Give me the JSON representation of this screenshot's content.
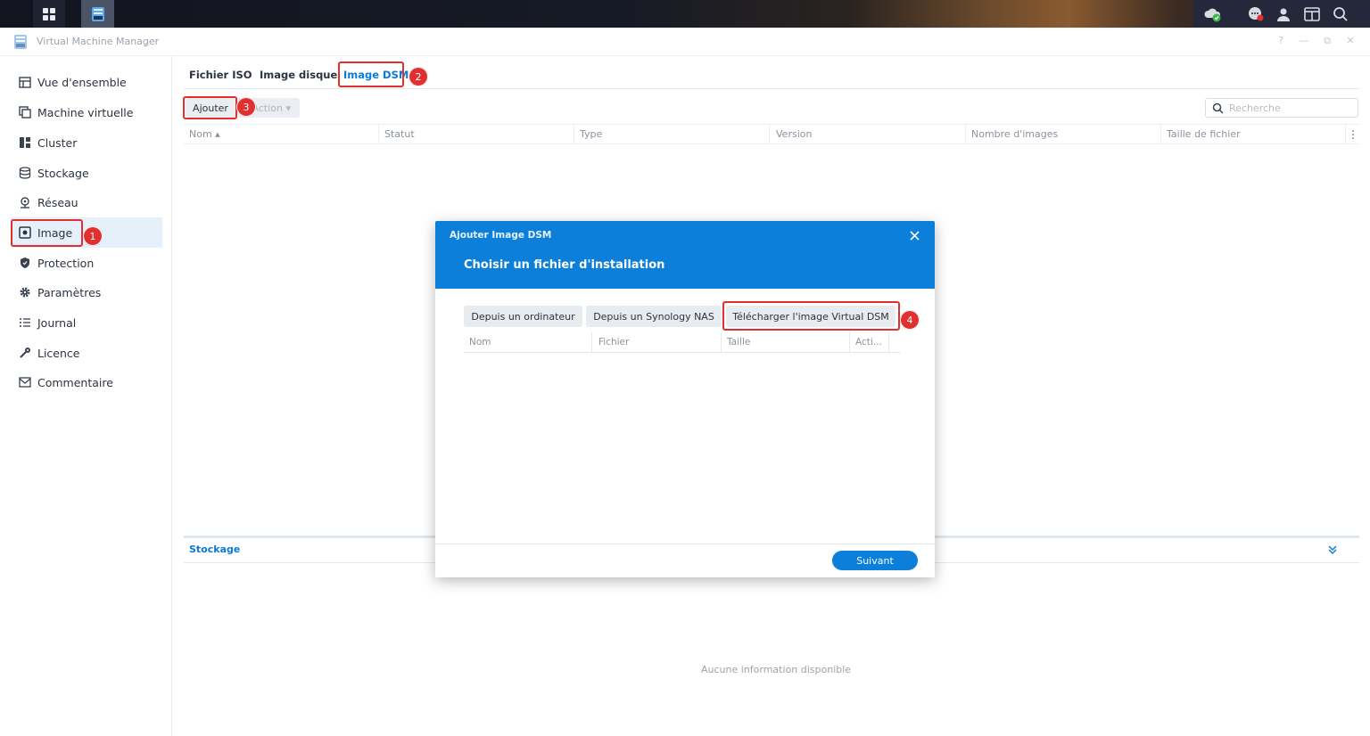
{
  "app": {
    "title": "Virtual Machine Manager"
  },
  "window_controls": [
    "?",
    "—",
    "⧉",
    "✕"
  ],
  "sidebar": {
    "items": [
      {
        "label": "Vue d'ensemble",
        "icon": "overview-icon"
      },
      {
        "label": "Machine virtuelle",
        "icon": "virtual-machine-icon"
      },
      {
        "label": "Cluster",
        "icon": "cluster-icon"
      },
      {
        "label": "Stockage",
        "icon": "storage-icon"
      },
      {
        "label": "Réseau",
        "icon": "network-icon"
      },
      {
        "label": "Image",
        "icon": "image-icon",
        "active": true
      },
      {
        "label": "Protection",
        "icon": "shield-icon"
      },
      {
        "label": "Paramètres",
        "icon": "gear-icon"
      },
      {
        "label": "Journal",
        "icon": "list-icon"
      },
      {
        "label": "Licence",
        "icon": "key-icon"
      },
      {
        "label": "Commentaire",
        "icon": "mail-icon"
      }
    ]
  },
  "tabs": [
    {
      "label": "Fichier ISO"
    },
    {
      "label": "Image disque"
    },
    {
      "label": "Image DSM",
      "active": true
    }
  ],
  "toolbar": {
    "add_label": "Ajouter",
    "action_label": "Action ▾",
    "search_placeholder": "Recherche"
  },
  "grid": {
    "columns": [
      "Nom ▴",
      "Statut",
      "Type",
      "Version",
      "Nombre d'images",
      "Taille de fichier"
    ]
  },
  "storage_panel": {
    "title": "Stockage",
    "empty_message": "Aucune information disponible"
  },
  "dialog": {
    "title": "Ajouter Image DSM",
    "subtitle": "Choisir un fichier d'installation",
    "sources": [
      "Depuis un ordinateur",
      "Depuis un Synology NAS",
      "Télécharger l'image Virtual DSM"
    ],
    "columns": [
      "Nom",
      "Fichier",
      "Taille",
      "Acti..."
    ],
    "next_label": "Suivant"
  },
  "annotations": [
    "1",
    "2",
    "3",
    "4"
  ],
  "colors": {
    "accent": "#0b7fd9",
    "highlight": "#e0302f",
    "active_bg": "#e6f0fb"
  }
}
